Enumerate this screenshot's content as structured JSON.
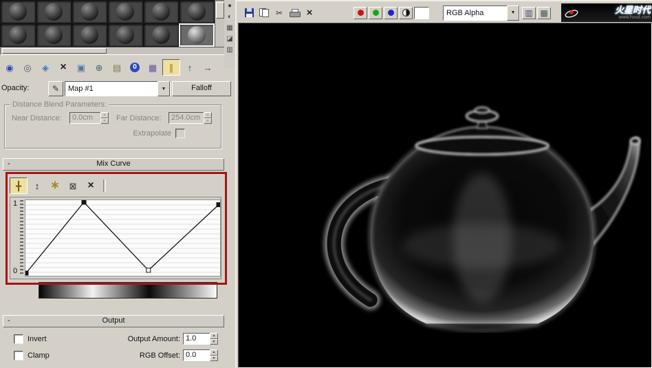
{
  "material_editor": {
    "sample_slots": {
      "rows": 2,
      "cols": 6,
      "selected_row": 1,
      "selected_col": 5
    },
    "vertical_toolbar": [
      {
        "name": "sample-type-button",
        "glyph": "●",
        "color": "#444444"
      },
      {
        "name": "backlight-button",
        "glyph": "◐",
        "color": "#444444"
      },
      {
        "name": "background-button",
        "glyph": "▦",
        "color": "#444444"
      },
      {
        "name": "sample-uv-tiling-button",
        "glyph": "◪",
        "color": "#444444"
      },
      {
        "name": "video-color-check-button",
        "glyph": "▥",
        "color": "#444444"
      }
    ],
    "toolbar": [
      {
        "name": "get-material-button",
        "glyph": "◉",
        "color": "#2f4db0"
      },
      {
        "name": "put-material-to-scene-button",
        "glyph": "◎",
        "color": "#555566"
      },
      {
        "name": "assign-material-to-selection-button",
        "glyph": "◈",
        "color": "#4477aa"
      },
      {
        "name": "reset-map-button",
        "glyph": "×",
        "color": "#222222",
        "big": true
      },
      {
        "name": "make-material-copy-button",
        "glyph": "▣",
        "color": "#557799"
      },
      {
        "name": "make-unique-button",
        "glyph": "⊕",
        "color": "#446666"
      },
      {
        "name": "put-to-library-button",
        "glyph": "▤",
        "color": "#887755"
      },
      {
        "name": "material-id-channel-button",
        "glyph": "0",
        "round": true
      },
      {
        "name": "show-map-in-viewport-button",
        "glyph": "▦",
        "color": "#665599"
      },
      {
        "name": "show-end-result-button",
        "glyph": "∥",
        "color": "#aa7700",
        "pressed": true
      },
      {
        "name": "go-to-parent-button",
        "glyph": "↑",
        "color": "#334466"
      },
      {
        "name": "go-forward-to-sibling-button",
        "glyph": "→",
        "color": "#334466"
      }
    ],
    "opacity_row": {
      "label": "Opacity:",
      "map_name": "Map #1",
      "type_button": "Falloff"
    },
    "distance_blend": {
      "title": "Distance Blend Parameters:",
      "near_label": "Near Distance:",
      "near_value": "0.0cm",
      "far_label": "Far Distance:",
      "far_value": "254.0cm",
      "extrapolate_label": "Extrapolate"
    },
    "mix_curve": {
      "title": "Mix Curve",
      "toolbar": [
        {
          "name": "move-button",
          "glyph": "╋",
          "color": "#7a5c10",
          "pressed": true
        },
        {
          "name": "scale-point-button",
          "glyph": "↕",
          "color": "#222222"
        },
        {
          "name": "add-point-button",
          "glyph": "∗",
          "color": "#a78a1f",
          "big": true
        },
        {
          "name": "delete-point-button",
          "glyph": "⊠",
          "color": "#333333"
        },
        {
          "name": "reset-curves-button",
          "glyph": "×",
          "color": "#222222",
          "big": true
        },
        {
          "sep": true
        }
      ],
      "y_top_label": "1",
      "y_bottom_label": "0",
      "points": [
        {
          "x": 0.0,
          "y": 0.0,
          "style": "filled"
        },
        {
          "x": 0.3,
          "y": 1.0,
          "style": "filled"
        },
        {
          "x": 0.635,
          "y": 0.04,
          "style": "open"
        },
        {
          "x": 1.0,
          "y": 0.965,
          "style": "filled"
        }
      ]
    },
    "gradient_stops": [
      [
        0,
        "#050505"
      ],
      [
        0.3,
        "#f2f2f2"
      ],
      [
        0.62,
        "#0a0a0a"
      ],
      [
        1,
        "#fafafa"
      ]
    ],
    "output": {
      "title": "Output",
      "invert_label": "Invert",
      "clamp_label": "Clamp",
      "output_amount_label": "Output Amount:",
      "output_amount_value": "1.0",
      "rgb_offset_label": "RGB Offset:",
      "rgb_offset_value": "0.0"
    }
  },
  "render_window": {
    "toolbar": {
      "left_icons": [
        {
          "name": "save-bitmap-button",
          "cssIcon": "ic-disk"
        },
        {
          "name": "clone-window-button",
          "cssIcon": "ic-clone"
        },
        {
          "name": "cut-button",
          "glyph": "✂",
          "color": "#333333"
        },
        {
          "name": "print-button",
          "cssIcon": "ic-print"
        },
        {
          "name": "clear-button",
          "glyph": "×",
          "color": "#222222",
          "big": true
        }
      ],
      "channel_buttons": [
        {
          "name": "red-channel-button",
          "dot": "#cc1111"
        },
        {
          "name": "green-channel-button",
          "dot": "#11aa11"
        },
        {
          "name": "blue-channel-button",
          "dot": "#2222cc"
        },
        {
          "name": "monochrome-button",
          "mono": true
        },
        {
          "name": "background-color-swatch",
          "swatch": "#ffffff"
        }
      ],
      "channel_dropdown": "RGB Alpha",
      "right_icons": [
        {
          "name": "channel-layers-button",
          "glyph": "▥",
          "color": "#444466"
        },
        {
          "name": "image-options-button",
          "glyph": "▩",
          "color": "#445555"
        }
      ]
    },
    "brand": {
      "logo_text": "火星时代",
      "url_text": "www.hxsd.com"
    }
  }
}
